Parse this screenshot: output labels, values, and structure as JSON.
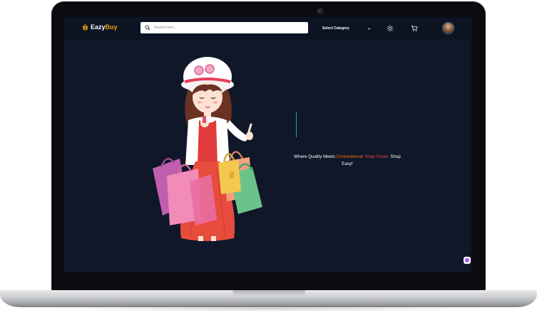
{
  "app": {
    "logo_part1": "Eazy",
    "logo_part2": "Buy",
    "brand_color": "#f59e0b",
    "background_color": "#0f1729"
  },
  "navbar": {
    "search": {
      "placeholder": "Search here...",
      "value": "",
      "icon": "search-icon"
    },
    "category": {
      "selected": "Select Category",
      "icon": "chevron-down-icon"
    },
    "theme_toggle": {
      "icon": "sun-icon"
    },
    "cart": {
      "icon": "cart-icon"
    },
    "avatar": {
      "icon": "user-avatar"
    }
  },
  "hero": {
    "tagline_part1": "Where Quality Meets ",
    "tagline_highlight1": "Convenience!",
    "tagline_highlight2": "Shop Smart.",
    "tagline_part2": " Shop Easy!",
    "illustration": "girl-with-shopping-bags",
    "highlight1_color": "#f97316",
    "highlight2_color": "#ef4444"
  },
  "chat": {
    "icon": "chat-bubble-icon"
  }
}
